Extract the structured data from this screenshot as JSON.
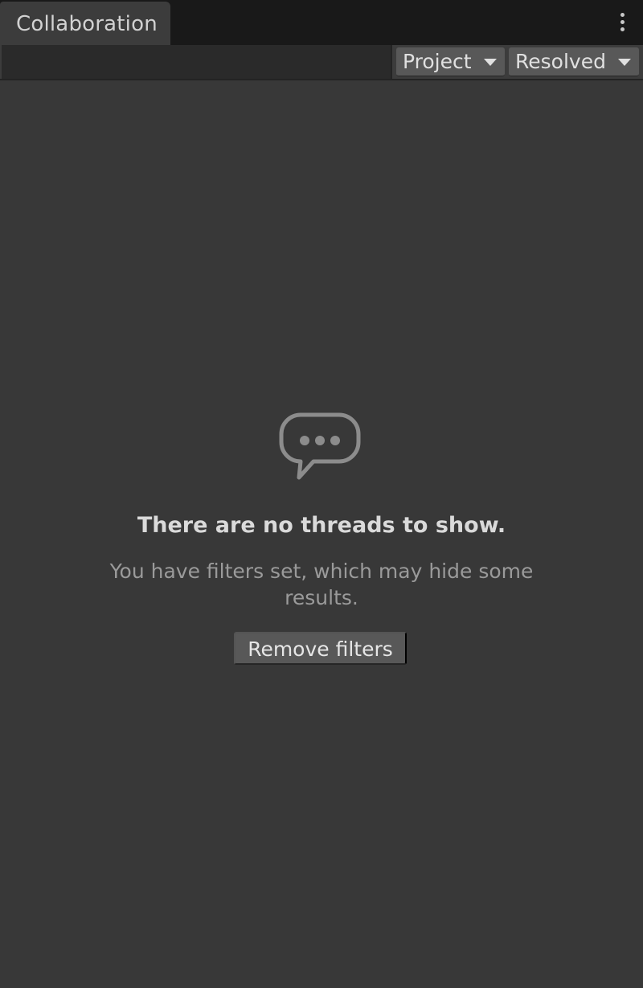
{
  "window": {
    "tab_label": "Collaboration",
    "menu_icon": "kebab-menu-icon"
  },
  "toolbar": {
    "search_placeholder": "",
    "project_filter": {
      "selected": "Project"
    },
    "status_filter": {
      "selected": "Resolved"
    }
  },
  "empty_state": {
    "icon": "speech-bubble-icon",
    "title": "There are no threads to show.",
    "subtitle": "You have filters set, which may hide some results.",
    "button_label": "Remove filters"
  },
  "colors": {
    "background": "#383838",
    "tabbar": "#191919",
    "button": "#585858",
    "text": "#dadada",
    "muted_text": "#9a9a9a"
  }
}
